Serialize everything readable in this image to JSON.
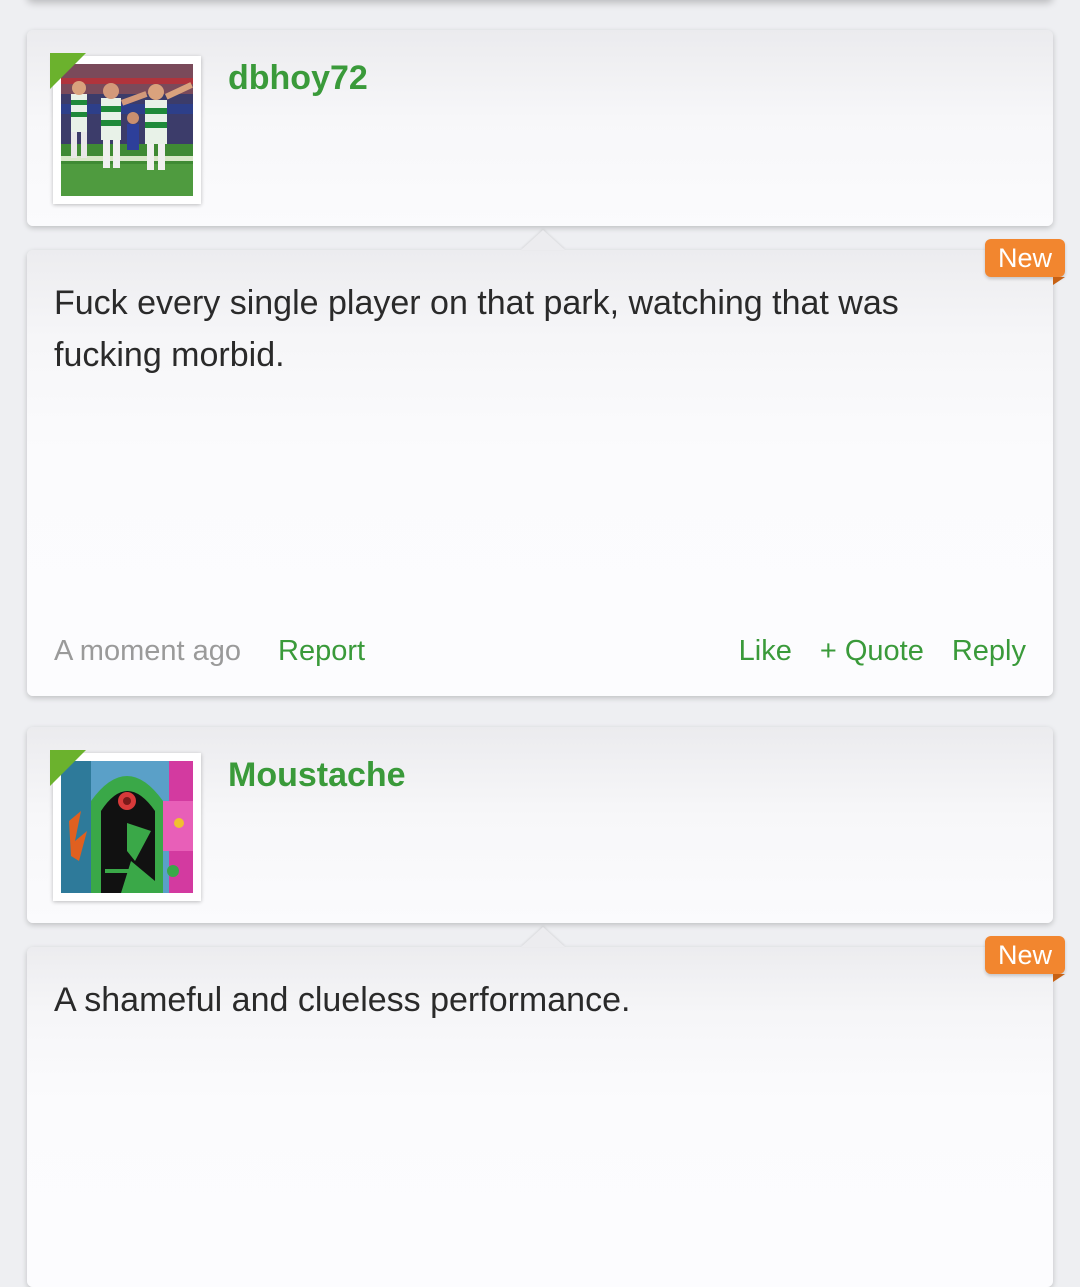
{
  "posts": [
    {
      "username": "dbhoy72",
      "avatar": "celtic-football-celebration-photo",
      "badge": "New",
      "text": "Fuck every single player on that park, watching that was fucking morbid.",
      "timestamp": "A moment ago",
      "report": "Report",
      "like": "Like",
      "quote": "+ Quote",
      "reply": "Reply"
    },
    {
      "username": "Moustache",
      "avatar": "green-abstract-face-illustration",
      "badge": "New",
      "text": "A shameful and clueless performance."
    }
  ],
  "colors": {
    "accent_green": "#3a9a3a",
    "corner_green": "#6bb22d",
    "badge_orange": "#f2862f",
    "muted_text": "#9a9a9a"
  }
}
